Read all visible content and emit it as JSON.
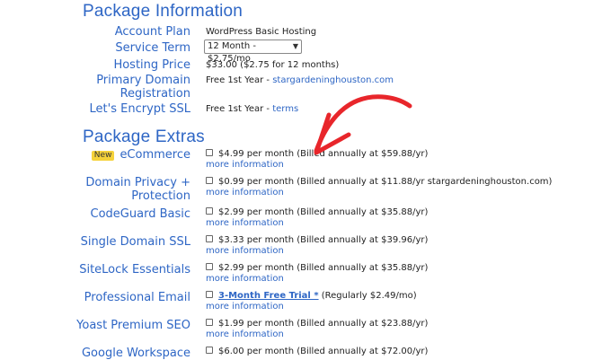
{
  "package_information": {
    "title": "Package Information",
    "account_plan": {
      "label": "Account Plan",
      "value": "WordPress Basic Hosting"
    },
    "service_term": {
      "label": "Service Term",
      "selected": "12 Month - $2.75/mo"
    },
    "hosting_price": {
      "label": "Hosting Price",
      "value": "$33.00 ($2.75 for 12 months)"
    },
    "domain_registration": {
      "label_line1": "Primary Domain",
      "label_line2": "Registration",
      "value_prefix": "Free 1st Year - ",
      "domain": "stargardeninghouston.com"
    },
    "ssl": {
      "label": "Let's Encrypt SSL",
      "value_prefix": "Free 1st Year - ",
      "link": "terms"
    }
  },
  "package_extras": {
    "title": "Package Extras",
    "more_info": "more information",
    "items": [
      {
        "badge": "New",
        "label": "eCommerce",
        "price": "$4.99 per month (Billed annually at $59.88/yr)"
      },
      {
        "label_line1": "Domain Privacy +",
        "label_line2": "Protection",
        "price": "$0.99 per month (Billed annually at $11.88/yr stargardeninghouston.com)"
      },
      {
        "label": "CodeGuard Basic",
        "price": "$2.99 per month (Billed annually at $35.88/yr)"
      },
      {
        "label": "Single Domain SSL",
        "price": "$3.33 per month (Billed annually at $39.96/yr)"
      },
      {
        "label": "SiteLock Essentials",
        "price": "$2.99 per month (Billed annually at $35.88/yr)"
      },
      {
        "label": "Professional Email",
        "trial": "3-Month Free Trial *",
        "price": " (Regularly $2.49/mo)"
      },
      {
        "label": "Yoast Premium SEO",
        "price": "$1.99 per month (Billed annually at $23.88/yr)"
      },
      {
        "label": "Google Workspace",
        "price": "$6.00 per month (Billed annually at $72.00/yr)"
      }
    ]
  },
  "colors": {
    "link_blue": "#2e66c5",
    "arrow_red": "#e8262b",
    "badge_yellow": "#f5d23a"
  }
}
